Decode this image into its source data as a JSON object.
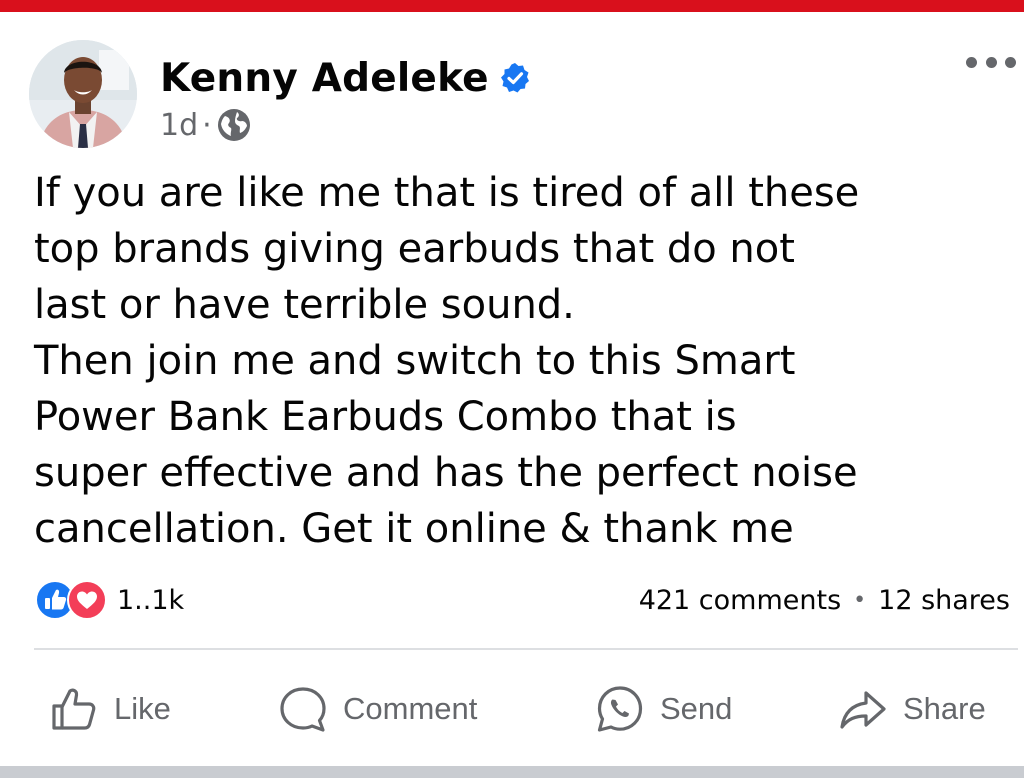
{
  "post": {
    "author": "Kenny Adeleke",
    "verified": true,
    "time": "1d",
    "separator": "·",
    "audience_icon": "globe-icon",
    "lines": [
      "If you are like me that is tired of all these",
      "top brands giving earbuds that do not",
      "last or have terrible sound.",
      "Then join me and switch to this Smart",
      "Power Bank Earbuds Combo that is",
      "super effective and has the perfect noise",
      "cancellation. Get it online & thank me"
    ]
  },
  "engagement": {
    "reaction_icons": [
      "like-reaction-icon",
      "love-reaction-icon"
    ],
    "reaction_count": "1..1k",
    "comments": "421 comments",
    "separator": "•",
    "shares": "12 shares"
  },
  "actions": {
    "like": "Like",
    "comment": "Comment",
    "send": "Send",
    "share": "Share"
  },
  "colors": {
    "top_bar": "#d9101c",
    "verified_badge": "#1877f2",
    "like_reaction": "#1877f2",
    "love_reaction": "#f33e58",
    "secondary_text": "#65676b"
  }
}
